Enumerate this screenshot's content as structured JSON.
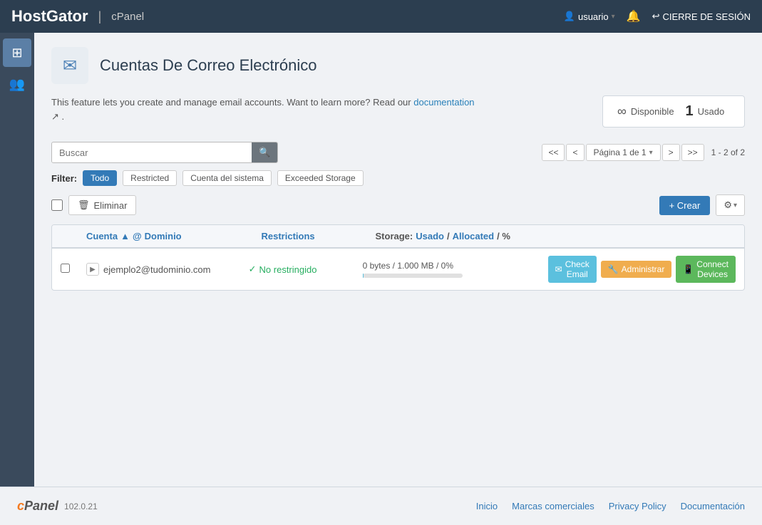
{
  "brand": {
    "hostgator": "HostGator",
    "cpanel": "cPanel"
  },
  "topnav": {
    "user": "usuario",
    "logout": "CIERRE DE SESIÓN"
  },
  "page": {
    "title": "Cuentas De Correo Electrónico",
    "icon": "✉"
  },
  "info": {
    "text_before_link": "This feature lets you create and manage email accounts. Want to learn more? Read our",
    "link_text": "documentation",
    "text_after_link": "."
  },
  "usage": {
    "disponible_label": "Disponible",
    "usado_label": "Usado",
    "count": "1"
  },
  "search": {
    "placeholder": "Buscar"
  },
  "pagination": {
    "first": "<<",
    "prev": "<",
    "info": "Página 1 de 1",
    "next": ">",
    "last": ">>",
    "count": "1 - 2 of 2"
  },
  "filters": {
    "label": "Filter:",
    "options": [
      "Todo",
      "Restricted",
      "Cuenta del sistema",
      "Exceeded Storage"
    ]
  },
  "actions": {
    "delete_label": "Eliminar",
    "create_label": "+ Crear"
  },
  "table": {
    "headers": {
      "account": "Cuenta",
      "domain": "Dominio",
      "restrictions": "Restrictions",
      "storage_label": "Storage:",
      "storage_used": "Usado",
      "storage_slash": "/",
      "storage_allocated": "Allocated",
      "storage_percent": "/ %"
    },
    "rows": [
      {
        "email": "ejemplo2@tudominio.com",
        "account": "ejemplo2",
        "domain": "tudominio.com",
        "restriction": "No restringido",
        "restriction_icon": "✓",
        "storage_text": "0 bytes / 1.000 MB / 0%",
        "storage_pct": 1,
        "btn_check": "Check Email",
        "btn_admin": "Administrar",
        "btn_connect": "Connect Devices"
      }
    ]
  },
  "footer": {
    "cpanel": "cPanel",
    "version": "102.0.21",
    "links": [
      "Inicio",
      "Marcas comerciales",
      "Privacy Policy",
      "Documentación"
    ]
  }
}
